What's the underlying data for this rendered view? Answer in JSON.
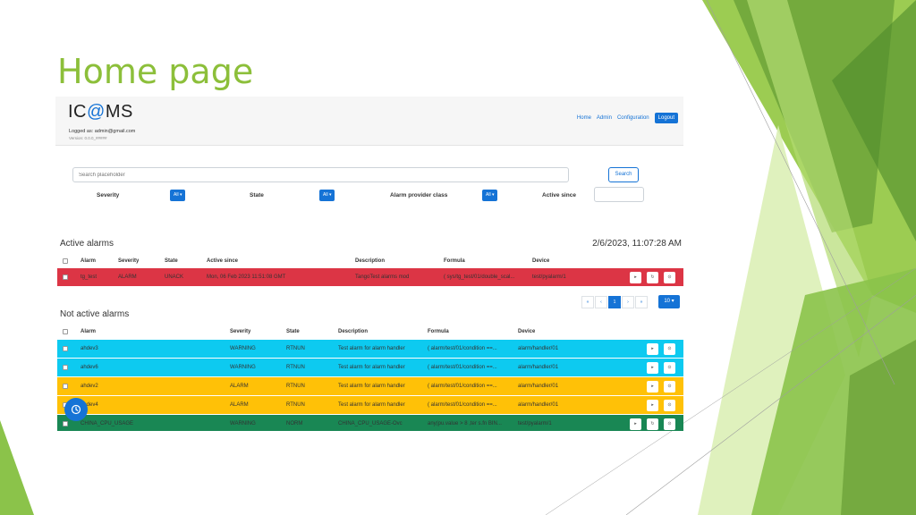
{
  "slide": {
    "title": "Home page"
  },
  "header": {
    "logo": "IC@MS",
    "logged_in": "Logged as: admin@gmail.com",
    "version": "Version: 0.0.0_#####",
    "nav": [
      "Home",
      "Admin",
      "Configuration"
    ],
    "logout_label": "Logout"
  },
  "search": {
    "placeholder": "Search placeholder",
    "button_label": "Search"
  },
  "filters": {
    "severity_label": "Severity",
    "severity_value": "All ▾",
    "state_label": "State",
    "state_value": "All ▾",
    "provider_label": "Alarm provider class",
    "provider_value": "All ▾",
    "since_label": "Active since"
  },
  "active": {
    "title": "Active alarms",
    "datetime": "2/6/2023, 11:07:28 AM",
    "columns": [
      "Alarm",
      "Severity",
      "State",
      "Active since",
      "Description",
      "Formula",
      "Device"
    ],
    "rows": [
      {
        "alarm": "tg_test",
        "severity": "ALARM",
        "state": "UNACK",
        "since": "Mon, 06 Feb 2023 11:51:08 GMT",
        "description": "TangoTest alarms mod",
        "formula": "( sys/tg_test/01/double_scal...",
        "device": "test/pyalarm/1",
        "color": "#dc3545"
      }
    ]
  },
  "pagination": {
    "first": "«",
    "prev": "‹",
    "current": "1",
    "next": "›",
    "last": "»",
    "per_page": "10 ▾"
  },
  "inactive": {
    "title": "Not active alarms",
    "columns": [
      "Alarm",
      "Severity",
      "State",
      "Description",
      "Formula",
      "Device"
    ],
    "rows": [
      {
        "alarm": "ahdev3",
        "severity": "WARNING",
        "state": "RTNUN",
        "description": "Test alarm for alarm handler",
        "formula": "( alarm/test/01/condition ==...",
        "device": "alarm/handler/01",
        "color": "#0dcaf0"
      },
      {
        "alarm": "ahdev6",
        "severity": "WARNING",
        "state": "RTNUN",
        "description": "Test alarm for alarm handler",
        "formula": "( alarm/test/01/condition ==...",
        "device": "alarm/handler/01",
        "color": "#0dcaf0"
      },
      {
        "alarm": "ahdev2",
        "severity": "ALARM",
        "state": "RTNUN",
        "description": "Test alarm for alarm handler",
        "formula": "( alarm/test/01/condition ==...",
        "device": "alarm/handler/01",
        "color": "#ffc107"
      },
      {
        "alarm": "ahdev4",
        "severity": "ALARM",
        "state": "RTNUN",
        "description": "Test alarm for alarm handler",
        "formula": "( alarm/test/01/condition ==...",
        "device": "alarm/handler/01",
        "color": "#ffc107"
      },
      {
        "alarm": "CHINA_CPU_USAGE",
        "severity": "WARNING",
        "state": "NORM",
        "description": "CHINA_CPU_USAGE-Ovc",
        "formula": "any(pu.value > 8 ,ter s.fn BIN...",
        "device": "test/pyalarm/1",
        "color": "#198754"
      }
    ]
  },
  "colors": {
    "accent": "#1573d6",
    "title_green": "#8cbf3a"
  },
  "icons": {
    "row_action": "play-icon",
    "row_refresh": "refresh-icon",
    "row_ack": "acknowledge-icon",
    "fab": "clock-icon"
  }
}
